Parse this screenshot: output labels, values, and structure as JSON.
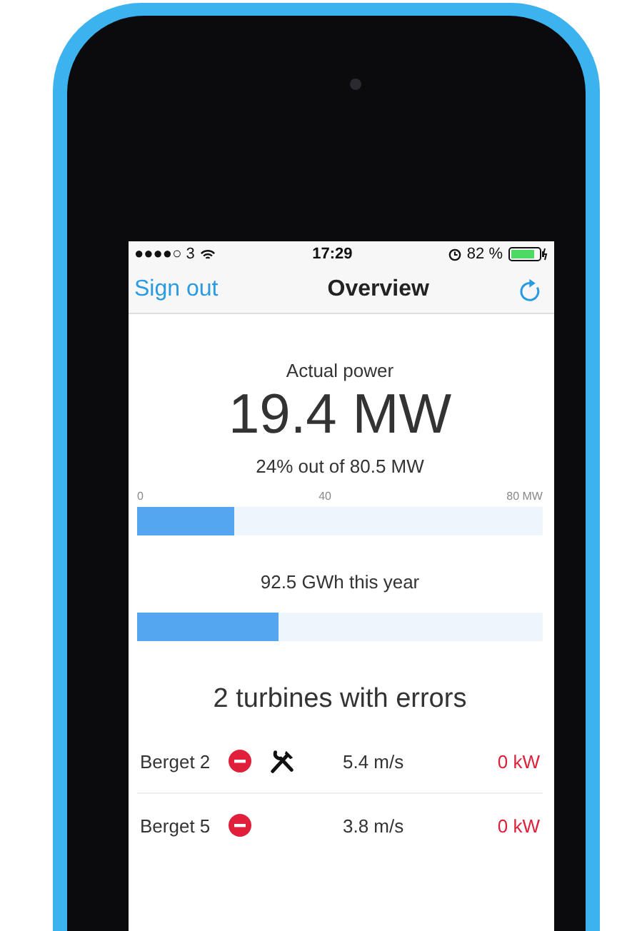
{
  "status_bar": {
    "signal": "●●●●○ 3",
    "time": "17:29",
    "battery": "82 %"
  },
  "nav_bar": {
    "left_button": "Sign out",
    "title": "Overview"
  },
  "power": {
    "label": "Actual power",
    "value": "19.4 MW",
    "share": "24% out of 80.5 MW",
    "axis_labels": [
      "0",
      "40",
      "80 MW"
    ],
    "level": 0.24
  },
  "energy": {
    "label": "92.5 GWh this year",
    "level": 0.35
  },
  "errors": {
    "heading": "2 turbines with errors",
    "rows": [
      {
        "name": "Berget 2",
        "error": true,
        "service": true,
        "wind": "5.4 m/s",
        "output": "0 kW"
      },
      {
        "name": "Berget 5",
        "error": true,
        "service": false,
        "wind": "3.8 m/s",
        "output": "0 kW"
      }
    ]
  }
}
